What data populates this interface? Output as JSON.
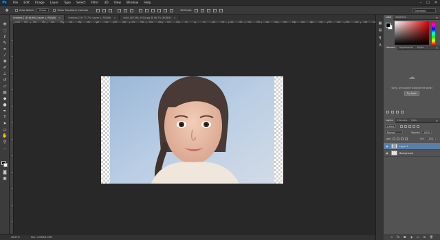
{
  "menubar": {
    "logo": "Ps",
    "items": [
      "File",
      "Edit",
      "Image",
      "Layer",
      "Type",
      "Select",
      "Filter",
      "3D",
      "View",
      "Window",
      "Help"
    ],
    "window_controls": [
      "–",
      "□",
      "✕"
    ]
  },
  "options": {
    "auto_select_label": "Auto-Select:",
    "auto_select_target": "Group",
    "show_transform_label": "Show Transform Controls",
    "mode_3d_label": "3D Mode:",
    "workspace": "Essentials"
  },
  "tabs": [
    {
      "label": "Untitled-1 @ 46.6% (Layer 1, RGB/8)",
      "active": true
    },
    {
      "label": "Untitled-2 @ 77.7% (Layer 1, RGB/8)",
      "active": false
    },
    {
      "label": "child-187196_1920.jpg @ 46.7% (RGB/8)",
      "active": false
    }
  ],
  "ruler_numbers": [
    "1000",
    "950",
    "900",
    "850",
    "800",
    "750",
    "700",
    "650",
    "600",
    "550",
    "500",
    "450",
    "400",
    "350",
    "300",
    "250",
    "200",
    "150",
    "100",
    "50",
    "0",
    "50",
    "100",
    "150",
    "200",
    "250",
    "300",
    "350",
    "400",
    "450",
    "500",
    "550",
    "600",
    "650",
    "700",
    "750",
    "800",
    "850",
    "900",
    "950",
    "1000"
  ],
  "status": {
    "zoom": "46.67%",
    "doc": "Doc: 4.00M/4.00M"
  },
  "panels": {
    "color_tabs": [
      "Color",
      "Swatches"
    ],
    "library_tabs": [
      "Libraries",
      "Adjustments",
      "Styles"
    ],
    "library_message": "Sorry, we couldn't initialize the panel",
    "library_button": "Try Again",
    "layers_tabs": [
      "Layers",
      "Channels",
      "Paths"
    ],
    "filter_kind": "ρ Kind",
    "blend_mode": "Normal",
    "opacity_label": "Opacity:",
    "opacity_value": "100%",
    "lock_label": "Lock:",
    "fill_label": "Fill:",
    "fill_value": "100%",
    "layers": [
      {
        "name": "Layer 1",
        "selected": true
      },
      {
        "name": "Background",
        "selected": false
      }
    ]
  },
  "colors": {
    "accent": "#31a8ff",
    "selected_layer": "#5a7ea8",
    "foreground": "#000000",
    "background": "#ffffff"
  }
}
